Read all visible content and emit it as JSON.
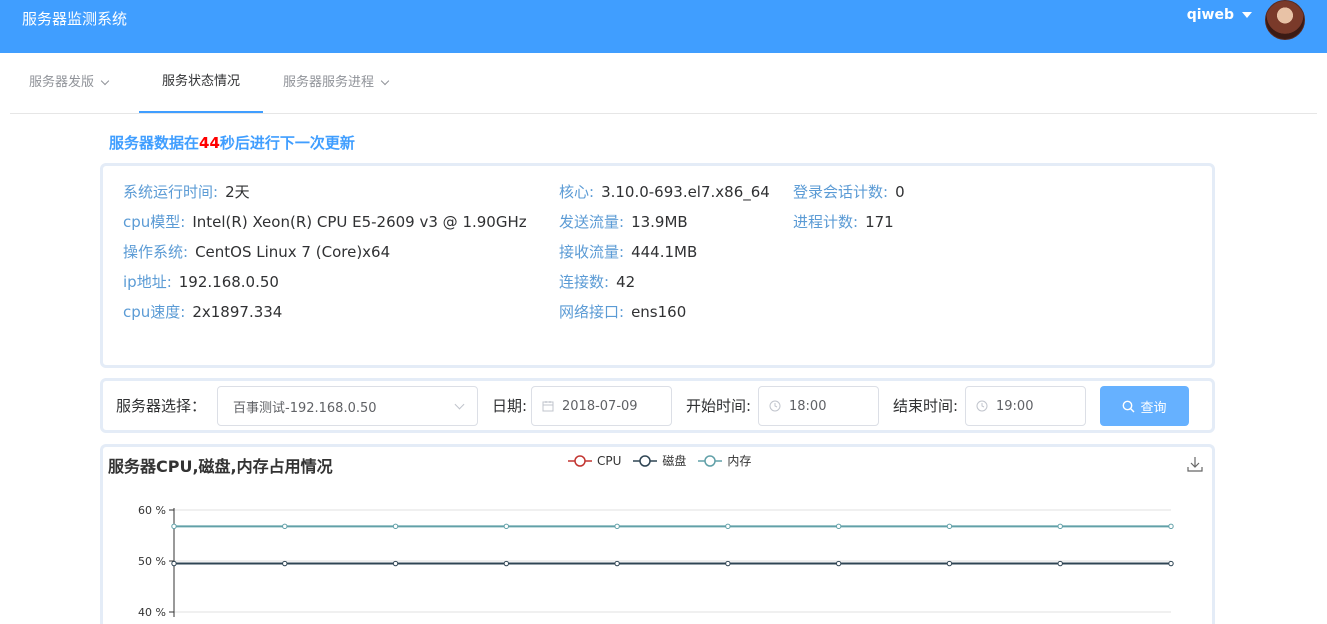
{
  "header": {
    "app_title": "服务器监测系统",
    "username": "qiweb"
  },
  "nav": {
    "items": [
      {
        "label": "服务器发版",
        "has_dropdown": true,
        "active": false
      },
      {
        "label": "服务状态情况",
        "has_dropdown": false,
        "active": true
      },
      {
        "label": "服务器服务进程",
        "has_dropdown": true,
        "active": false
      }
    ]
  },
  "update_notice": {
    "prefix": "服务器数据在",
    "seconds": "44",
    "suffix": "秒后进行下一次更新"
  },
  "system_info": {
    "col1": [
      {
        "label": "系统运行时间:",
        "value": "2天"
      },
      {
        "label": "cpu模型:",
        "value": "Intel(R) Xeon(R) CPU E5-2609 v3 @ 1.90GHz"
      },
      {
        "label": "操作系统:",
        "value": "CentOS Linux 7 (Core)x64"
      },
      {
        "label": "ip地址:",
        "value": "192.168.0.50"
      },
      {
        "label": "cpu速度:",
        "value": "2x1897.334"
      }
    ],
    "col2": [
      {
        "label": "核心:",
        "value": "3.10.0-693.el7.x86_64"
      },
      {
        "label": "发送流量:",
        "value": "13.9MB"
      },
      {
        "label": "接收流量:",
        "value": "444.1MB"
      },
      {
        "label": "连接数:",
        "value": "42"
      },
      {
        "label": "网络接口:",
        "value": "ens160"
      }
    ],
    "col3": [
      {
        "label": "登录会话计数:",
        "value": "0"
      },
      {
        "label": "进程计数:",
        "value": "171"
      }
    ]
  },
  "query": {
    "server_label": "服务器选择：",
    "server_value": "百事测试-192.168.0.50",
    "date_label": "日期:",
    "date_value": "2018-07-09",
    "start_label": "开始时间:",
    "start_value": "18:00",
    "end_label": "结束时间:",
    "end_value": "19:00",
    "button_label": "查询",
    "icons": {
      "calendar": "calendar-icon",
      "clock": "clock-icon",
      "search": "search-icon"
    }
  },
  "chart_data": {
    "type": "line",
    "title": "服务器CPU,磁盘,内存占用情况",
    "y_tick_labels": [
      "60 %",
      "50 %",
      "40 %"
    ],
    "y_ticks": [
      60,
      50,
      40
    ],
    "ylim": [
      40,
      60
    ],
    "points": 10,
    "series": [
      {
        "name": "CPU",
        "color": "#c23531",
        "values": []
      },
      {
        "name": "磁盘",
        "color": "#2f4554",
        "values": [
          49.5,
          49.5,
          49.5,
          49.5,
          49.5,
          49.5,
          49.5,
          49.5,
          49.5,
          49.5
        ]
      },
      {
        "name": "内存",
        "color": "#61a0a8",
        "values": [
          56.8,
          56.8,
          56.8,
          56.8,
          56.8,
          56.8,
          56.8,
          56.8,
          56.8,
          56.8
        ]
      }
    ],
    "grid": true,
    "legend_position": "top-center"
  },
  "colors": {
    "header_bg": "#409eff",
    "accent": "#409eff",
    "button_bg": "#66b1ff",
    "highlight": "#ff0000"
  }
}
